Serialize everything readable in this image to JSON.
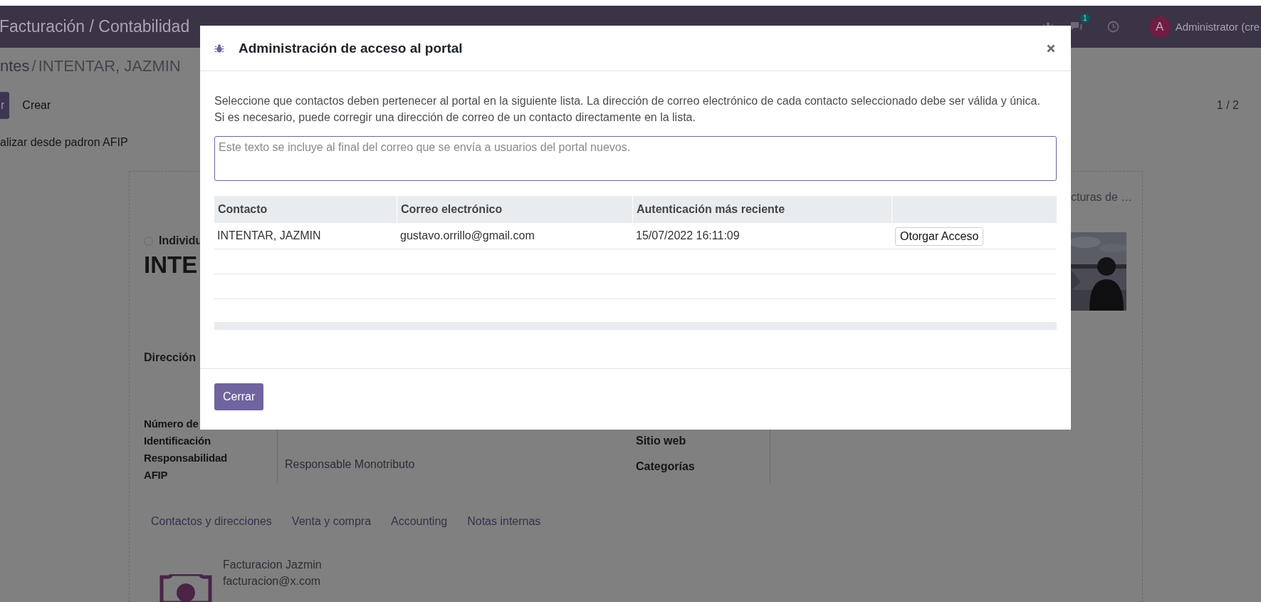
{
  "navbar": {
    "app_title": "Facturación / Contabilidad",
    "chat_badge": "1",
    "avatar_letter": "A",
    "user": "Administrator (cre"
  },
  "breadcrumb": {
    "parent": "ntes",
    "separator": "/",
    "current": "INTENTAR, JAZMIN"
  },
  "control_panel": {
    "primary_button": "r",
    "create_button": "Crear",
    "pager": "1 / 2",
    "action": "alizar desde padron AFIP"
  },
  "form": {
    "smart_button": "cturas de …",
    "company_type": {
      "label": "Individu",
      "selected": false
    },
    "name": "INTE",
    "address_label": "Dirección",
    "fields_left": [
      {
        "label": "Número de Identificación"
      },
      {
        "label": "Responsabilidad AFIP",
        "value": "Responsable Monotributo"
      }
    ],
    "fields_right": [
      {
        "label": "Sitio web"
      },
      {
        "label": "Categorías"
      }
    ],
    "tabs": [
      {
        "label": "Contactos y direcciones",
        "selected": false
      },
      {
        "label": "Venta y compra",
        "selected": false
      },
      {
        "label": "Accounting",
        "selected": false
      },
      {
        "label": "Notas internas",
        "selected": false
      }
    ],
    "contact_card": {
      "name": "Facturacion Jazmin",
      "email": "facturacion@x.com"
    }
  },
  "modal": {
    "title": "Administración de acceso al portal",
    "intro_lines": [
      "Seleccione que contactos deben pertenecer al portal en la siguiente lista. La dirección de correo electrónico de cada contacto seleccionado debe ser válida y única.",
      "Si es necesario, puede corregir una dirección de correo de un contacto directamente en la lista."
    ],
    "welcome_message": {
      "placeholder": "Este texto se incluye al final del correo que se envía a usuarios del portal nuevos."
    },
    "table": {
      "columns": [
        "Contacto",
        "Correo electrónico",
        "Autenticación más reciente"
      ],
      "rows": [
        {
          "contact": "INTENTAR, JAZMIN",
          "email": "gustavo.orrillo@gmail.com",
          "login": "15/07/2022 16:11:09",
          "action": "Otorgar Acceso"
        }
      ]
    },
    "close_button": "Cerrar"
  }
}
